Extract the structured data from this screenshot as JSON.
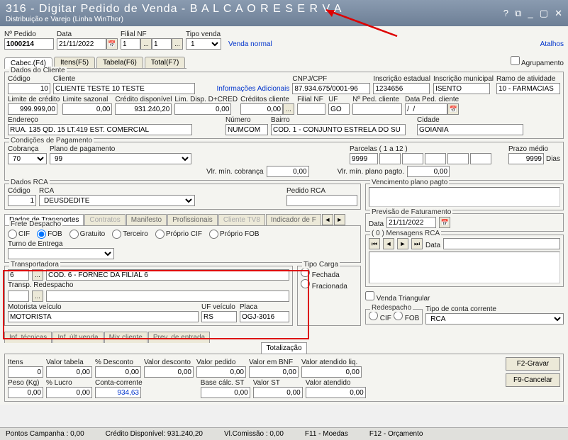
{
  "window": {
    "title": "316 - Digitar Pedido de Venda - B A L C A O  R E S E R V A",
    "subtitle": "Distribuição e Varejo (Linha WinThor)"
  },
  "header": {
    "atalhos": "Atalhos",
    "npedido_lbl": "Nº Pedido",
    "npedido": "1000214",
    "data_lbl": "Data",
    "data": "21/11/2022",
    "filialnf_lbl": "Filial NF",
    "filialnf": "1",
    "ellipsis1": "...",
    "filial2": "1",
    "ellipsis2": "...",
    "tipovenda_lbl": "Tipo venda",
    "tipovenda": "1",
    "venda_normal": "Venda normal",
    "agrupamento": "Agrupamento"
  },
  "tabs": {
    "cabec": "Cabec.(F4)",
    "itens": "Itens(F5)",
    "tabela": "Tabela(F6)",
    "total": "Total(F7)"
  },
  "cliente": {
    "legend": "Dados do Cliente",
    "codigo_lbl": "Código",
    "codigo": "10",
    "cliente_lbl": "Cliente",
    "cliente_nome": "CLIENTE TESTE 10 TESTE",
    "info_adic": "Informações Adicionais",
    "cnpj_lbl": "CNPJ/CPF",
    "cnpj": "87.934.675/0001-96",
    "insc_est_lbl": "Inscrição estadual",
    "insc_est": "1234656",
    "insc_mun_lbl": "Inscrição municipal",
    "insc_mun": "ISENTO",
    "ramo_lbl": "Ramo de atividade",
    "ramo": "10 - FARMÁCIAS",
    "limite_cred_lbl": "Limite de crédito",
    "limite_cred": "999.999,00",
    "limite_saz_lbl": "Limite sazonal",
    "limite_saz": "0,00",
    "cred_disp_lbl": "Crédito disponível",
    "cred_disp": "931.240,20",
    "lim_dcred_lbl": "Lim. Disp. D+CRED",
    "lim_dcred": "0,00",
    "cred_cliente_lbl": "Créditos cliente",
    "cred_cliente": "0,00",
    "ellipsis3": "...",
    "filialnf2_lbl": "Filial NF",
    "uf_lbl": "UF",
    "uf": "GO",
    "nped_cli_lbl": "Nº Ped. cliente",
    "dtped_cli_lbl": "Data Ped. cliente",
    "dtped_cli": "/  /",
    "endereco_lbl": "Endereço",
    "endereco": "RUA. 135 QD. 15 LT.419 EST. COMERCIAL",
    "numero_lbl": "Número",
    "numero": "NUMCOM",
    "bairro_lbl": "Bairro",
    "bairro": "COD. 1 - CONJUNTO ESTRELA DO SU",
    "cidade_lbl": "Cidade",
    "cidade": "GOIANIA"
  },
  "pagamento": {
    "legend": "Condições de Pagamento",
    "cobranca_lbl": "Cobrança",
    "cobranca": "70",
    "plano_lbl": "Plano de pagamento",
    "plano": "99",
    "parcelas_lbl": "Parcelas ( 1 a 12 )",
    "parcelas": "9999",
    "prazo_lbl": "Prazo médio",
    "prazo_val": "9999",
    "dias": "Dias",
    "vlrmin_cob_lbl": "Vlr. mín. cobrança",
    "vlrmin_cob": "0,00",
    "vlrmin_plano_lbl": "Vlr. mín. plano pagto.",
    "vlrmin_plano": "0,00"
  },
  "rca": {
    "legend": "Dados RCA",
    "codigo_lbl": "Código",
    "codigo": "1",
    "rca_lbl": "RCA",
    "rca_nome": "DEUSDEDITE",
    "pedido_rca_lbl": "Pedido RCA",
    "prev_lbl": "Previsão de Faturamento",
    "prev_data_lbl": "Data",
    "prev_data": "21/11/2022",
    "venc_plano_lbl": "Vencimento plano pagto",
    "msg_rca": "( 0 ) Mensagens RCA",
    "data_msg_lbl": "Data"
  },
  "subtabs": {
    "transportes": "Dados de Transportes",
    "contratos": "Contratos",
    "manifesto": "Manifesto",
    "profissionais": "Profissionais",
    "clientetv8": "Cliente TV8",
    "indicador": "Indicador de F"
  },
  "frete": {
    "legend": "Frete Despacho",
    "cif": "CIF",
    "fob": "FOB",
    "gratuito": "Gratuito",
    "terceiro": "Terceiro",
    "propcif": "Próprio CIF",
    "propfob": "Próprio FOB",
    "turno_lbl": "Turno de Entrega"
  },
  "transportadora": {
    "legend": "Transportadora",
    "cod": "6",
    "ellipsis": "...",
    "nome": "COD. 6 - FORNEC DA FILIAL 6",
    "redesp_lbl": "Transp. Redespacho",
    "ellipsis2": "...",
    "motorista_lbl": "Motorista veículo",
    "motorista": "MOTORISTA",
    "ufveic_lbl": "UF veículo",
    "ufveic": "RS",
    "placa_lbl": "Placa",
    "placa": "OGJ-3016",
    "tipocarga_lbl": "Tipo Carga",
    "fechada": "Fechada",
    "fracionada": "Fracionada",
    "redespacho_lbl": "Redespacho",
    "rcif": "CIF",
    "rfob": "FOB",
    "vendatri": "Venda Triangular",
    "tipoconta_lbl": "Tipo de conta corrente",
    "tipoconta": "RCA"
  },
  "bottomtabs": {
    "inftec": "Inf. técnicas",
    "infult": "Inf. últ.venda",
    "mixcli": "Mix cliente",
    "prevent": "Prev. de entrada",
    "totalizacao": "Totalização"
  },
  "totals": {
    "itens_lbl": "Itens",
    "itens": "0",
    "vlrtab_lbl": "Valor tabela",
    "vlrtab": "0,00",
    "pdesc_lbl": "% Desconto",
    "pdesc": "0,00",
    "vlrdesc_lbl": "Valor desconto",
    "vlrdesc": "0,00",
    "vlrped_lbl": "Valor pedido",
    "vlrped": "0,00",
    "vlrbnf_lbl": "Valor em BNF",
    "vlrbnf": "0,00",
    "vlratliq_lbl": "Valor atendido liq.",
    "vlratliq": "0,00",
    "peso_lbl": "Peso (Kg)",
    "peso": "0,00",
    "plucro_lbl": "% Lucro",
    "plucro": "0,00",
    "contacorr_lbl": "Conta-corrente",
    "contacorr": "934,63",
    "basest_lbl": "Base cálc. ST",
    "basest": "0,00",
    "vlrst_lbl": "Valor ST",
    "vlrst": "0,00",
    "vlrat_lbl": "Valor atendido",
    "vlrat": "0,00"
  },
  "buttons": {
    "gravar": "F2-Gravar",
    "cancelar": "F9-Cancelar"
  },
  "status": {
    "pontos": "Pontos Campanha : 0,00",
    "credito": "Crédito Disponível: 931.240,20",
    "comissao": "Vl.Comissão : 0,00",
    "moedas": "F11 - Moedas",
    "orcamento": "F12 - Orçamento"
  }
}
